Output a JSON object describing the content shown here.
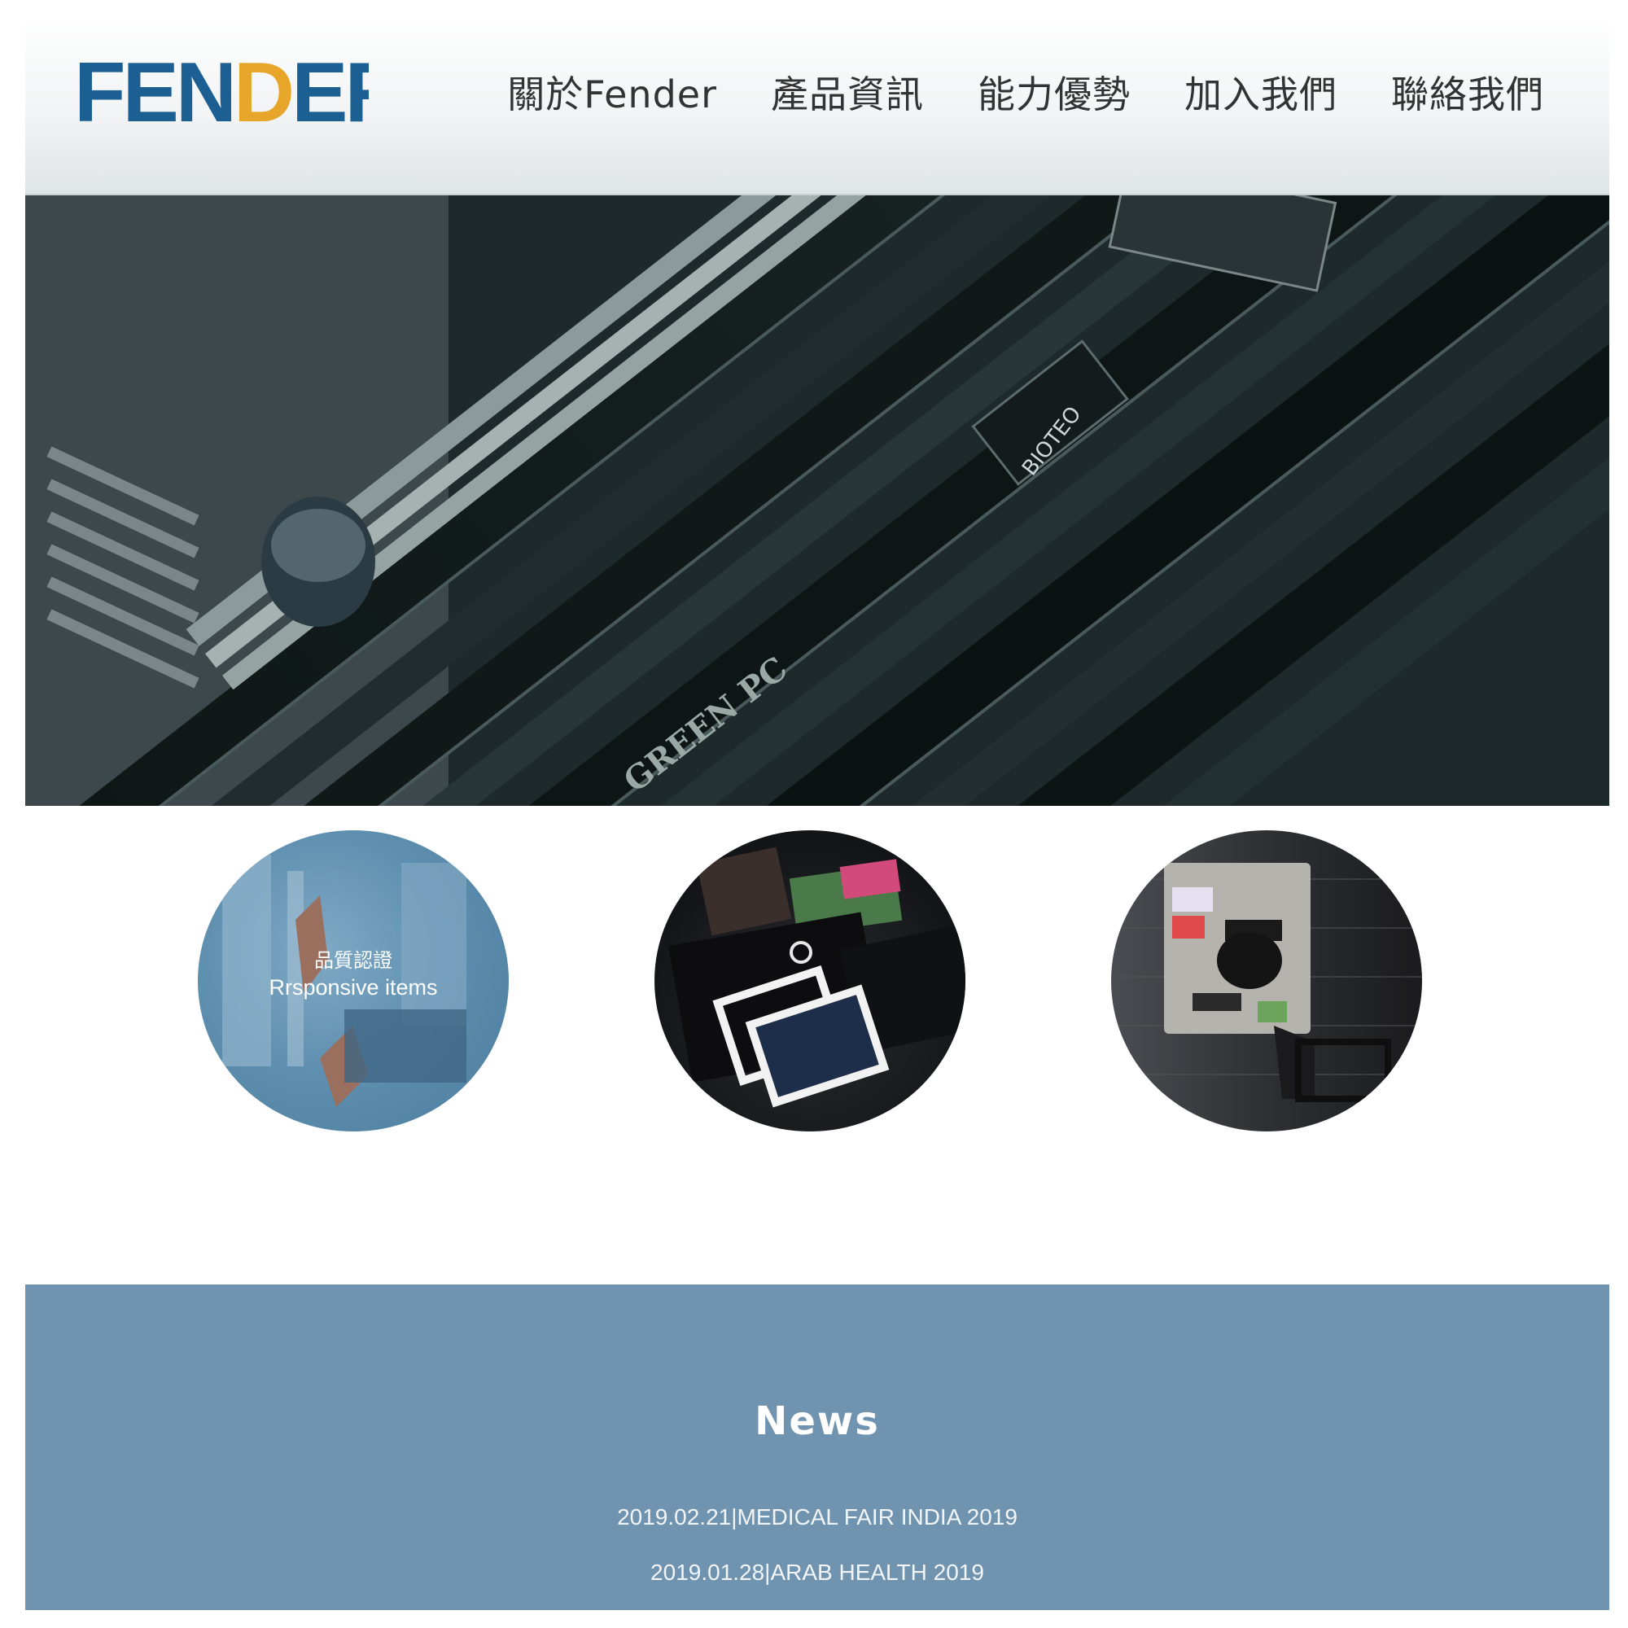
{
  "brand": {
    "logo_text": "FENDER",
    "colors": {
      "blue": "#1c5f93",
      "orange": "#e7a629"
    }
  },
  "nav": {
    "items": [
      {
        "label": "關於Fender"
      },
      {
        "label": "產品資訊"
      },
      {
        "label": "能力優勢"
      },
      {
        "label": "加入我們"
      },
      {
        "label": "聯絡我們"
      }
    ]
  },
  "hero": {
    "image": "circuit-board-photo",
    "board_label": "GREEN PC",
    "chip_label": "BIOTEO"
  },
  "features": [
    {
      "image": "factory-robot-photo",
      "title": "品質認證",
      "subtitle": "Rrsponsive items"
    },
    {
      "image": "unsplash-stickers-photo"
    },
    {
      "image": "sticker-laptop-photo"
    }
  ],
  "news": {
    "title": "News",
    "background": "#7093af",
    "items": [
      {
        "text": "2019.02.21|MEDICAL FAIR INDIA 2019"
      },
      {
        "text": "2019.01.28|ARAB HEALTH 2019"
      }
    ]
  }
}
